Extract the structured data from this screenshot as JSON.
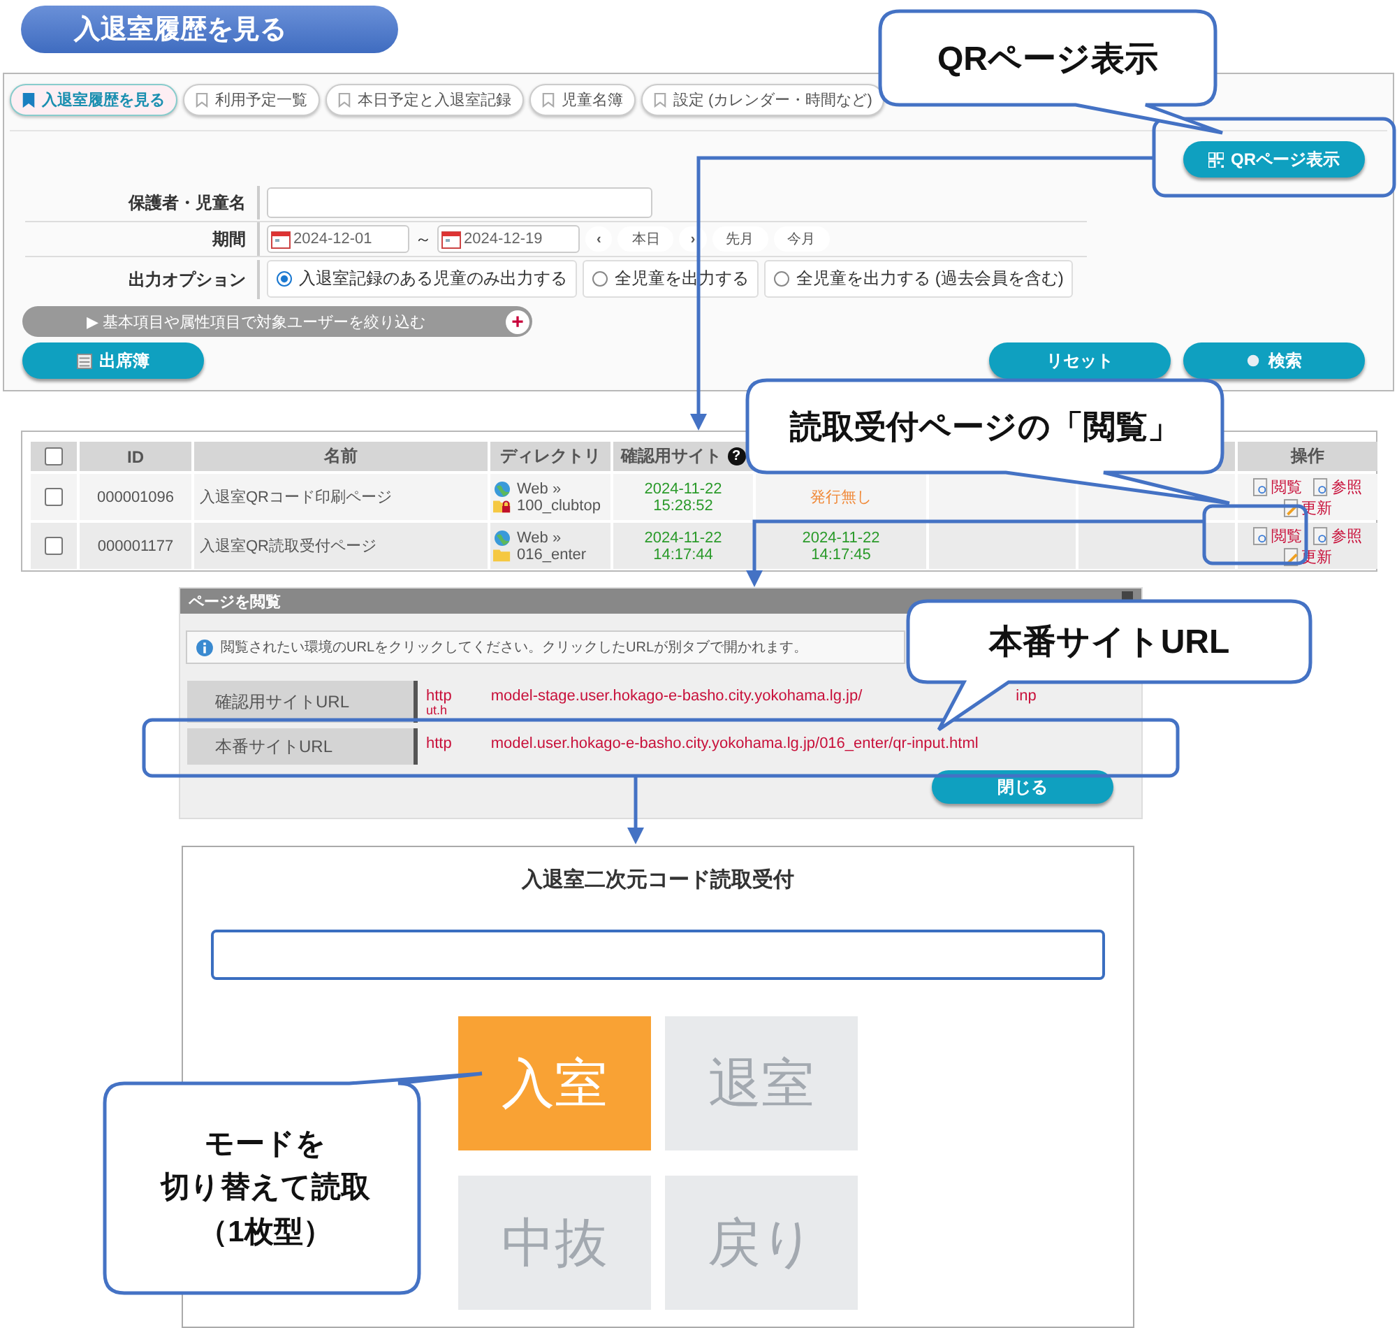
{
  "page_title": "入退室履歴を見る",
  "tabs": [
    {
      "label": "入退室履歴を見る",
      "selected": true
    },
    {
      "label": "利用予定一覧",
      "selected": false
    },
    {
      "label": "本日予定と入退室記録",
      "selected": false
    },
    {
      "label": "児童名簿",
      "selected": false
    },
    {
      "label": "設定 (カレンダー・時間など)",
      "selected": false
    }
  ],
  "qr_button": "QRページ表示",
  "form": {
    "name_label": "保護者・児童名",
    "period_label": "期間",
    "date_from": "2024-12-01",
    "tilde": "～",
    "date_to": "2024-12-19",
    "nav": [
      "‹",
      "本日",
      "›",
      "先月",
      "今月"
    ],
    "option_label": "出力オプション",
    "options": [
      {
        "label": "入退室記録のある児童のみ出力する",
        "selected": true
      },
      {
        "label": "全児童を出力する",
        "selected": false
      },
      {
        "label": "全児童を出力する (過去会員を含む)",
        "selected": false
      }
    ]
  },
  "filter_bar": {
    "arrow": "▶",
    "label": "基本項目や属性項目で対象ユーザーを絞り込む",
    "plus": "+"
  },
  "buttons": {
    "attendance": "出席簿",
    "reset": "リセット",
    "search": "検索"
  },
  "table": {
    "header_checked": false,
    "columns": [
      "ID",
      "名前",
      "ディレクトリ",
      "確認用サイト",
      "操作"
    ],
    "help_mark": "?",
    "rows": [
      {
        "checked": false,
        "id": "000001096",
        "name": "入退室QRコード印刷ページ",
        "dir_top": "Web »",
        "dir_folder": "100_clubtop",
        "locked": true,
        "confirm": [
          "2024-11-22",
          "15:28:52"
        ],
        "publish": {
          "kind": "status",
          "text": "発行無し"
        },
        "actions": [
          "閲覧",
          "参照",
          "更新"
        ]
      },
      {
        "checked": false,
        "id": "000001177",
        "name": "入退室QR読取受付ページ",
        "dir_top": "Web »",
        "dir_folder": "016_enter",
        "locked": false,
        "confirm": [
          "2024-11-22",
          "14:17:44"
        ],
        "publish": {
          "kind": "datetime",
          "text": "2024-11-22",
          "time": "14:17:45"
        },
        "actions": [
          "閲覧",
          "参照",
          "更新"
        ]
      }
    ]
  },
  "dialog": {
    "title": "ページを閲覧",
    "info": "閲覧されたい環境のURLをクリックしてください。クリックしたURLが別タブで開かれます。",
    "rows": [
      {
        "label": "確認用サイトURL",
        "url_start": "http",
        "url": "model-stage.user.hokago-e-basho.city.yokohama.lg.jp/",
        "url_tail": "inp",
        "url_line2": "ut.h"
      },
      {
        "label": "本番サイトURL",
        "url_start": "http",
        "url": "model.user.hokago-e-basho.city.yokohama.lg.jp/016_enter/qr-input.html"
      }
    ],
    "close": "閉じる"
  },
  "reader": {
    "title": "入退室二次元コード読取受付",
    "modes": [
      {
        "label": "入室",
        "selected": true
      },
      {
        "label": "退室",
        "selected": false
      },
      {
        "label": "中抜",
        "selected": false
      },
      {
        "label": "戻り",
        "selected": false
      }
    ]
  },
  "callouts": [
    {
      "lines": [
        "QRページ表示"
      ]
    },
    {
      "lines": [
        "読取受付ページの「閲覧」"
      ]
    },
    {
      "lines": [
        "本番サイトURL"
      ]
    },
    {
      "lines": [
        "モードを",
        "切り替えて読取",
        "（1枚型）"
      ]
    }
  ]
}
